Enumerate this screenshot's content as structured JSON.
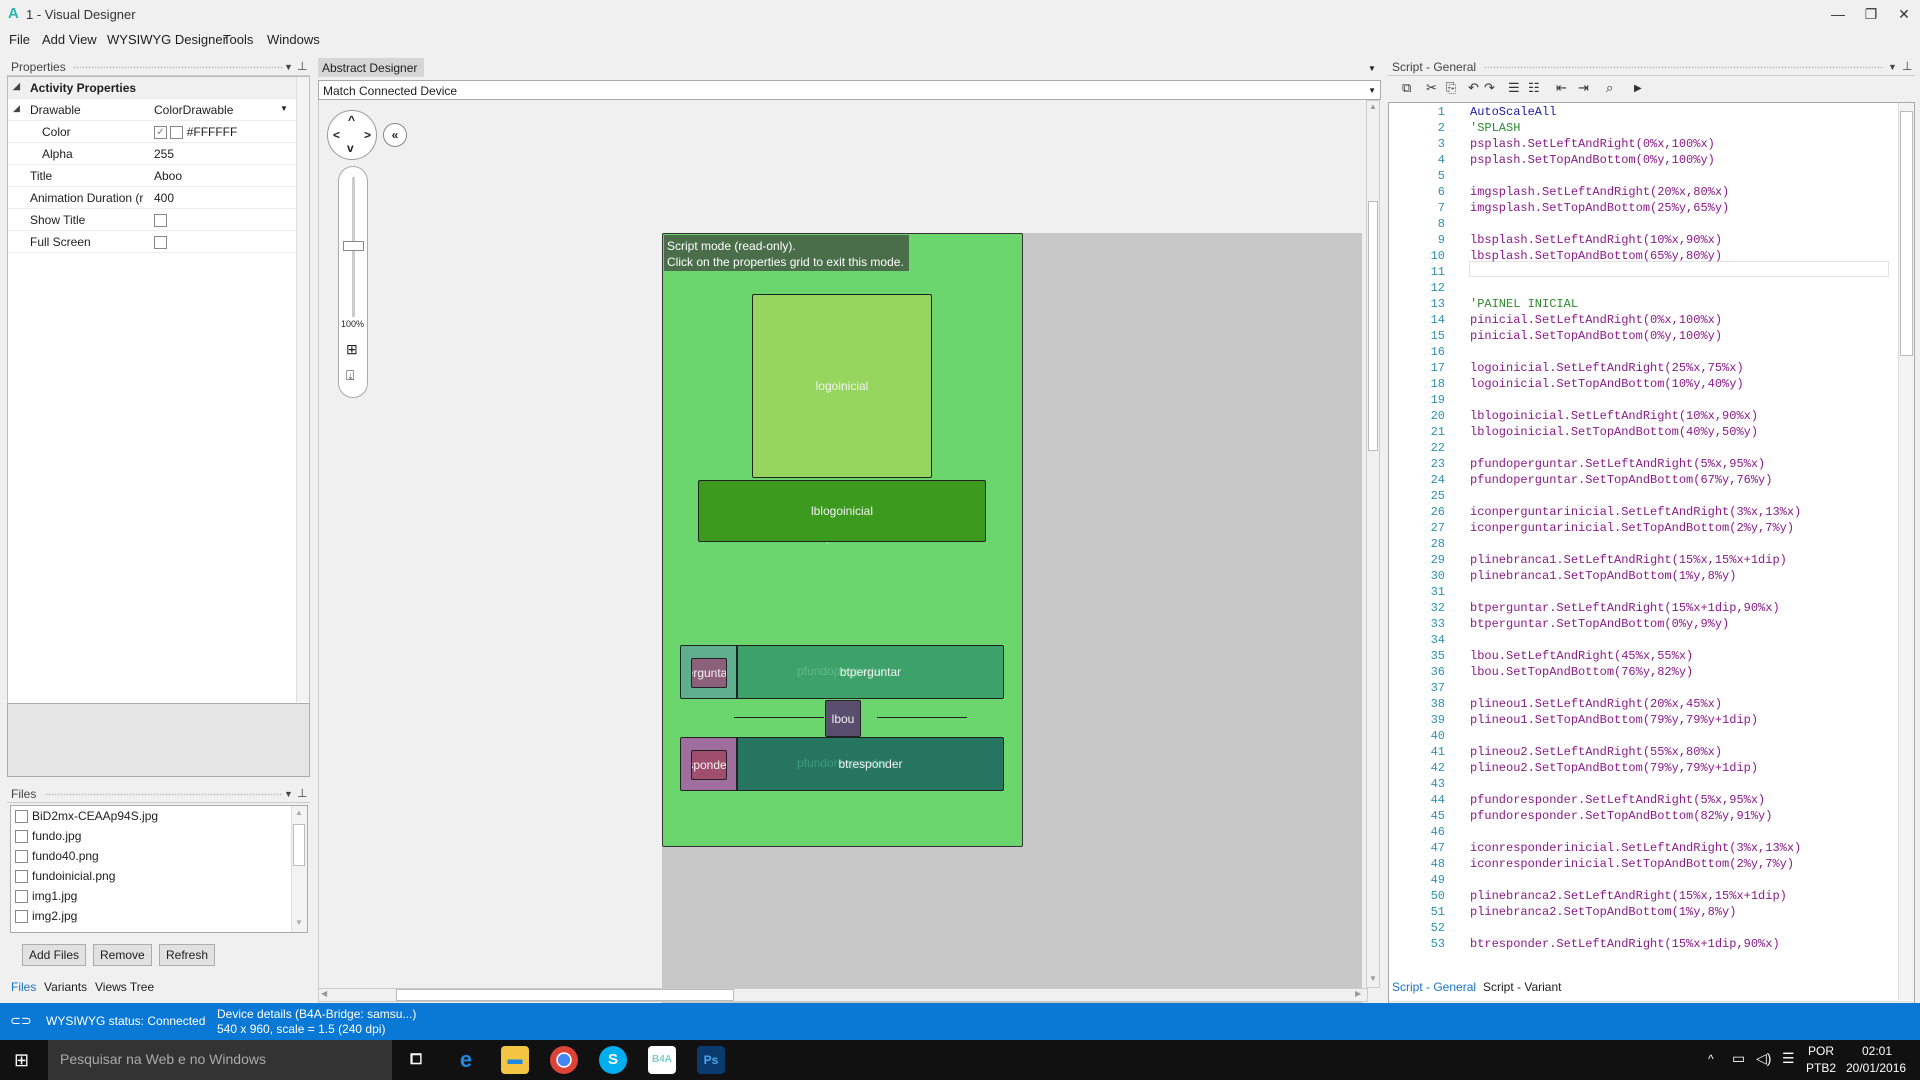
{
  "window": {
    "title": "1 - Visual Designer",
    "logo": "A",
    "controls": {
      "minimize": "—",
      "restore": "❐",
      "close": "✕"
    }
  },
  "menu": [
    "File",
    "Add View",
    "WYSIWYG Designer",
    "Tools",
    "Windows"
  ],
  "properties": {
    "header": "Properties",
    "category": "Activity Properties",
    "rows": [
      {
        "key": "Drawable",
        "value": "ColorDrawable"
      },
      {
        "key": "Color",
        "value": "#FFFFFF"
      },
      {
        "key": "Alpha",
        "value": "255"
      },
      {
        "key": "Title",
        "value": "Aboo"
      },
      {
        "key": "Animation Duration (r",
        "value": "400"
      },
      {
        "key": "Show Title",
        "value": ""
      },
      {
        "key": "Full Screen",
        "value": ""
      }
    ]
  },
  "files": {
    "header": "Files",
    "items": [
      "BiD2mx-CEAAp94S.jpg",
      "fundo.jpg",
      "fundo40.png",
      "fundoinicial.png",
      "img1.jpg",
      "img2.jpg"
    ],
    "buttons": {
      "add": "Add Files",
      "remove": "Remove",
      "refresh": "Refresh"
    },
    "tabs": [
      "Files",
      "Variants",
      "Views Tree"
    ]
  },
  "designer": {
    "tab": "Abstract Designer",
    "device_select": "Match Connected Device",
    "zoom_level": "100%",
    "script_note_line1": "Script mode (read-only).",
    "script_note_line2": "Click on the properties grid to exit this mode.",
    "views": {
      "logoinicial": "logoinicial",
      "lblogoinicial": "lblogoinicial",
      "pinicial": "pinicial",
      "btperguntar": "btperguntar",
      "pfundoperguntar": "pfundoperguntar",
      "iconperguntar": "erguntar",
      "lbou": "lbou",
      "btresponder": "btresponder",
      "pfundoresponder": "pfundoresponder",
      "iconresponder": "sponder"
    },
    "colors": {
      "background": "#6cd66e",
      "logo": "#96d65e",
      "label": "#3c9a1e",
      "perguntar": "#3da16a",
      "responder": "#267561",
      "icon_perg": "#8c5f7a",
      "icon_resp": "#a04e6e",
      "lbou": "#5a4e6e"
    }
  },
  "script": {
    "header": "Script - General",
    "tabs": [
      "Script - General",
      "Script - Variant"
    ],
    "lines": [
      "AutoScaleAll",
      "'SPLASH",
      "psplash.SetLeftAndRight(0%x,100%x)",
      "psplash.SetTopAndBottom(0%y,100%y)",
      "",
      "imgsplash.SetLeftAndRight(20%x,80%x)",
      "imgsplash.SetTopAndBottom(25%y,65%y)",
      "",
      "lbsplash.SetLeftAndRight(10%x,90%x)",
      "lbsplash.SetTopAndBottom(65%y,80%y)",
      "",
      "",
      "'PAINEL INICIAL",
      "pinicial.SetLeftAndRight(0%x,100%x)",
      "pinicial.SetTopAndBottom(0%y,100%y)",
      "",
      "logoinicial.SetLeftAndRight(25%x,75%x)",
      "logoinicial.SetTopAndBottom(10%y,40%y)",
      "",
      "lblogoinicial.SetLeftAndRight(10%x,90%x)",
      "lblogoinicial.SetTopAndBottom(40%y,50%y)",
      "",
      "pfundoperguntar.SetLeftAndRight(5%x,95%x)",
      "pfundoperguntar.SetTopAndBottom(67%y,76%y)",
      "",
      "iconperguntarinicial.SetLeftAndRight(3%x,13%x)",
      "iconperguntarinicial.SetTopAndBottom(2%y,7%y)",
      "",
      "plinebranca1.SetLeftAndRight(15%x,15%x+1dip)",
      "plinebranca1.SetTopAndBottom(1%y,8%y)",
      "",
      "btperguntar.SetLeftAndRight(15%x+1dip,90%x)",
      "btperguntar.SetTopAndBottom(0%y,9%y)",
      "",
      "lbou.SetLeftAndRight(45%x,55%x)",
      "lbou.SetTopAndBottom(76%y,82%y)",
      "",
      "plineou1.SetLeftAndRight(20%x,45%x)",
      "plineou1.SetTopAndBottom(79%y,79%y+1dip)",
      "",
      "plineou2.SetLeftAndRight(55%x,80%x)",
      "plineou2.SetTopAndBottom(79%y,79%y+1dip)",
      "",
      "pfundoresponder.SetLeftAndRight(5%x,95%x)",
      "pfundoresponder.SetTopAndBottom(82%y,91%y)",
      "",
      "iconresponderinicial.SetLeftAndRight(3%x,13%x)",
      "iconresponderinicial.SetTopAndBottom(2%y,7%y)",
      "",
      "plinebranca2.SetLeftAndRight(15%x,15%x+1dip)",
      "plinebranca2.SetTopAndBottom(1%y,8%y)",
      "",
      "btresponder.SetLeftAndRight(15%x+1dip,90%x)"
    ]
  },
  "status": {
    "wysiwyg": "WYSIWYG status: Connected",
    "device_line1": "Device details (B4A-Bridge: samsu...)",
    "device_line2": "540 x 960, scale = 1.5 (240 dpi)"
  },
  "taskbar": {
    "search_placeholder": "Pesquisar na Web e no Windows",
    "apps": [
      "task-view",
      "edge",
      "file-explorer",
      "chrome",
      "skype",
      "b4a",
      "photoshop"
    ],
    "lang1": "POR",
    "lang2": "PTB2",
    "time": "02:01",
    "date": "20/01/2016"
  }
}
